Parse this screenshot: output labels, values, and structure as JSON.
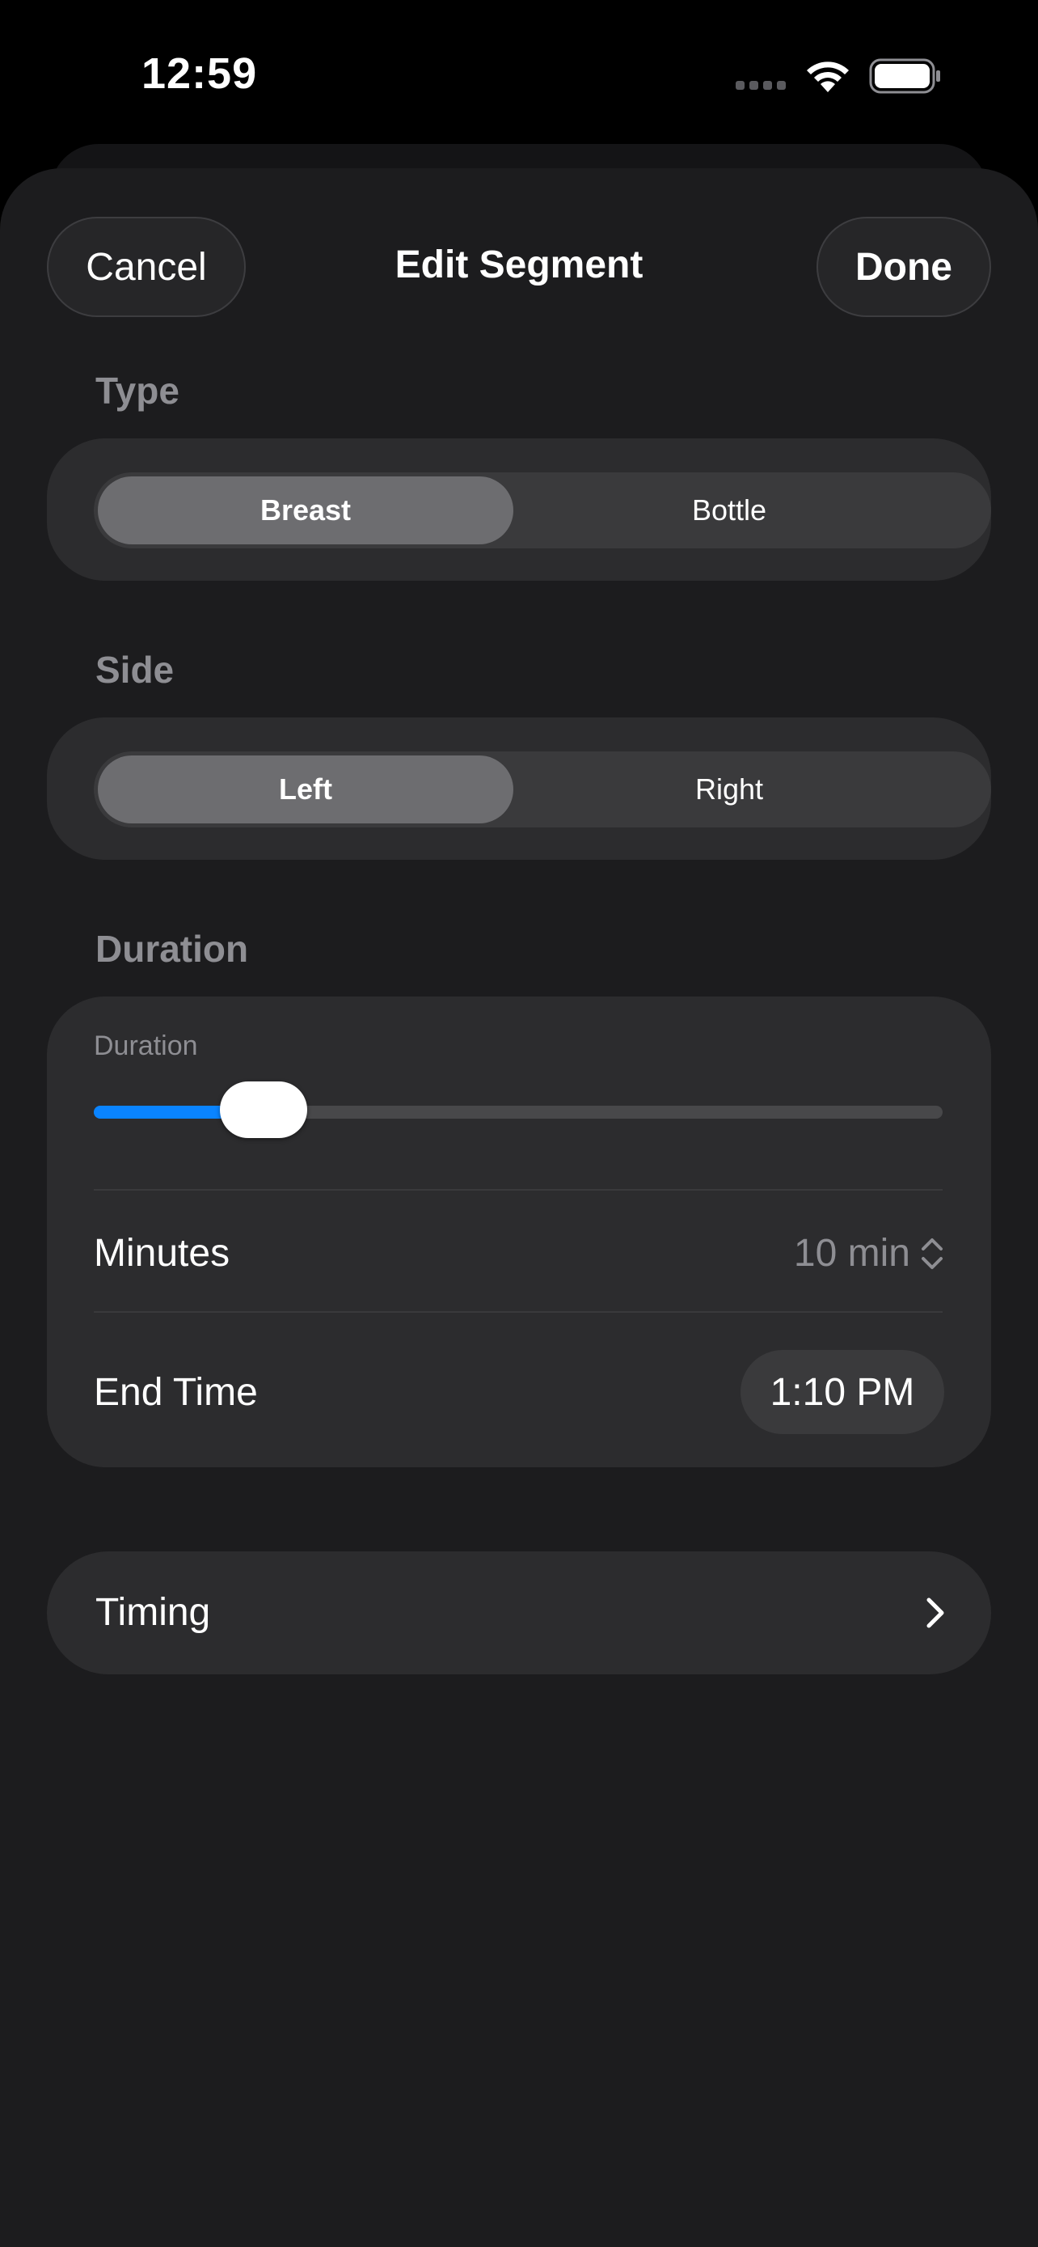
{
  "status_bar": {
    "time": "12:59"
  },
  "nav": {
    "cancel_label": "Cancel",
    "title": "Edit Segment",
    "done_label": "Done"
  },
  "type_section": {
    "label": "Type",
    "options": [
      "Breast",
      "Bottle"
    ],
    "selected": "Breast"
  },
  "side_section": {
    "label": "Side",
    "options": [
      "Left",
      "Right"
    ],
    "selected": "Left"
  },
  "duration_section": {
    "label": "Duration",
    "slider_caption": "Duration",
    "slider_value_fraction": 0.2,
    "minutes_label": "Minutes",
    "minutes_value": "10 min",
    "end_time_label": "End Time",
    "end_time_value": "1:10 PM"
  },
  "timing": {
    "label": "Timing"
  },
  "colors": {
    "accent": "#0a84ff",
    "background": "#1c1c1e",
    "card": "#2c2c2e",
    "secondary_text": "#8e8e93"
  }
}
